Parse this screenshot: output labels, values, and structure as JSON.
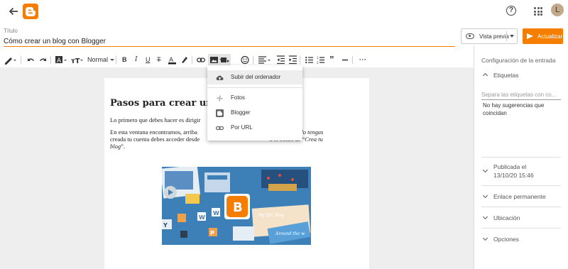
{
  "header": {
    "help_icon": "help-circle-icon",
    "apps_icon": "apps-grid-icon",
    "avatar_letter": "L"
  },
  "title": {
    "label": "Título",
    "value": "Cómo crear un blog con Blogger"
  },
  "actions": {
    "preview_label": "Vista previa",
    "update_label": "Actualizar"
  },
  "toolbar": {
    "font_label": "Normal"
  },
  "insert_image_menu": {
    "items": [
      {
        "label": "Subir del ordenador",
        "icon": "cloud-upload-icon"
      },
      {
        "label": "Fotos",
        "icon": "photos-pinwheel-icon"
      },
      {
        "label": "Blogger",
        "icon": "blogger-icon"
      },
      {
        "label": "Por URL",
        "icon": "link-icon"
      }
    ]
  },
  "document": {
    "heading": "Pasos para crear una",
    "p1": "Lo primero que debes hacer es dirigir",
    "p2_line1_a": "En esta ventana encontramos, arriba",
    "p2_line1_b": "sión”. Cuando tengas",
    "p2_line2_a": "creada tu cuenta debes acceder desde",
    "p2_line2_b": "n el botón de “",
    "p2_line2_c": "Crea tu",
    "p2_line3_a": "blog",
    "p2_line3_b": "”.",
    "image": {
      "logo_text": "B",
      "sign1": "My DIY Blog",
      "sign2": "Around the w",
      "tiles": [
        "Y",
        "W",
        "W",
        "Y",
        "P"
      ]
    }
  },
  "sidebar": {
    "heading": "Configuración de la entrada",
    "labels_title": "Etiquetas",
    "labels_placeholder": "Separa las etiquetas con co...",
    "no_suggestions": "No hay sugerencias que coincidan",
    "published_label": "Publicada el",
    "published_date": "13/10/20 15:46",
    "permalink": "Enlace permanente",
    "location": "Ubicación",
    "options": "Opciones"
  },
  "colors": {
    "accent": "#f57d00",
    "canvas": "#eeeeee",
    "image_bg": "#3d7fb7"
  }
}
